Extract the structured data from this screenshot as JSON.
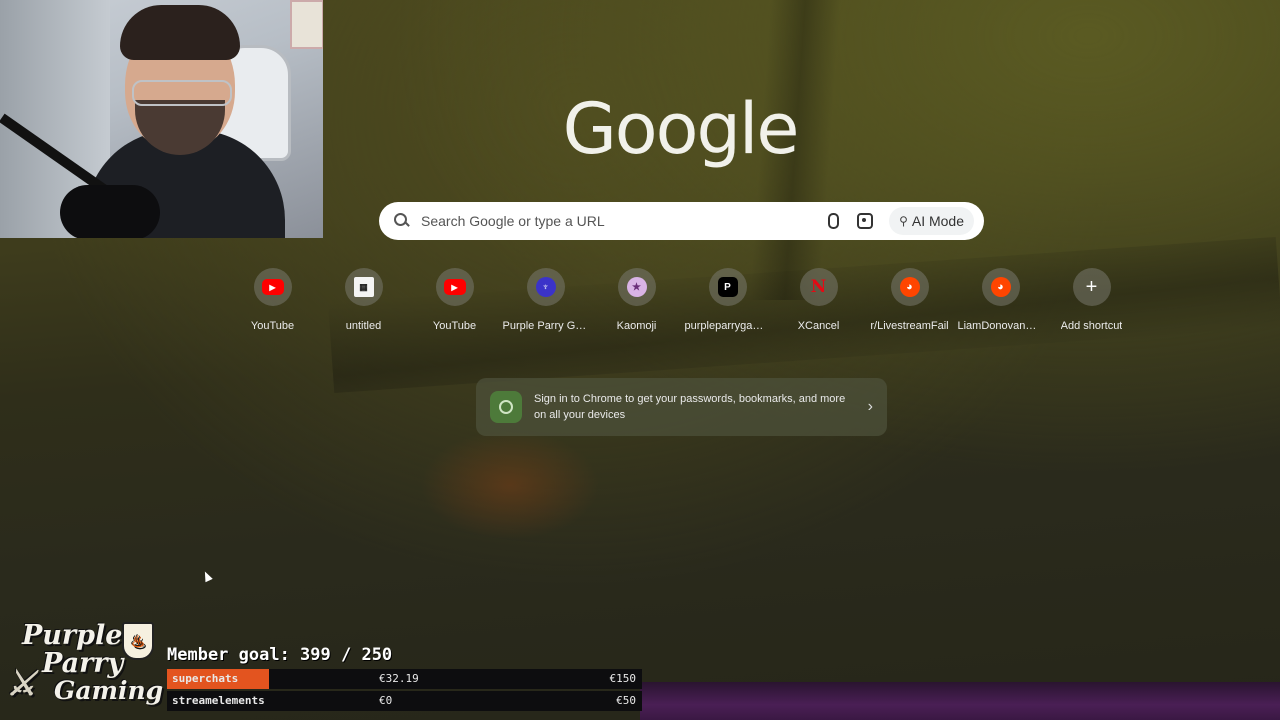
{
  "logo": {
    "text": "Google"
  },
  "search": {
    "placeholder": "Search Google or type a URL",
    "ai_mode_label": "AI Mode"
  },
  "shortcuts": [
    {
      "label": "YouTube",
      "icon": "youtube-icon"
    },
    {
      "label": "untitled",
      "icon": "document-icon"
    },
    {
      "label": "YouTube",
      "icon": "youtube-icon"
    },
    {
      "label": "Purple Parry Ga...",
      "icon": "purple-parry-icon"
    },
    {
      "label": "Kaomoji",
      "icon": "kaomoji-star-icon"
    },
    {
      "label": "purpleparrygam...",
      "icon": "patreon-icon"
    },
    {
      "label": "XCancel",
      "icon": "xcancel-n-icon"
    },
    {
      "label": "r/LivestreamFail",
      "icon": "reddit-icon"
    },
    {
      "label": "LiamDonovanM...",
      "icon": "reddit-icon"
    },
    {
      "label": "Add shortcut",
      "icon": "plus-icon"
    }
  ],
  "signin_card": {
    "text": "Sign in to Chrome to get your passwords, bookmarks, and more on all your devices",
    "icon": "account-icon"
  },
  "overlay": {
    "brand": {
      "line1": "Purple",
      "line2": "Parry",
      "line3": "Gaming"
    },
    "member_goal": "Member goal: 399 / 250",
    "tallies": [
      {
        "name": "superchats",
        "amount": "€32.19",
        "goal": "€150",
        "progress": 0.2146,
        "accent": "#e3541f"
      },
      {
        "name": "streamelements",
        "amount": "€0",
        "goal": "€50",
        "progress": 0,
        "accent": "#e3541f"
      }
    ]
  },
  "colors": {
    "search_bg": "#ffffff",
    "tally_bar": "#e3541f",
    "youtube_red": "#ff0000",
    "reddit_orange": "#ff4500"
  }
}
